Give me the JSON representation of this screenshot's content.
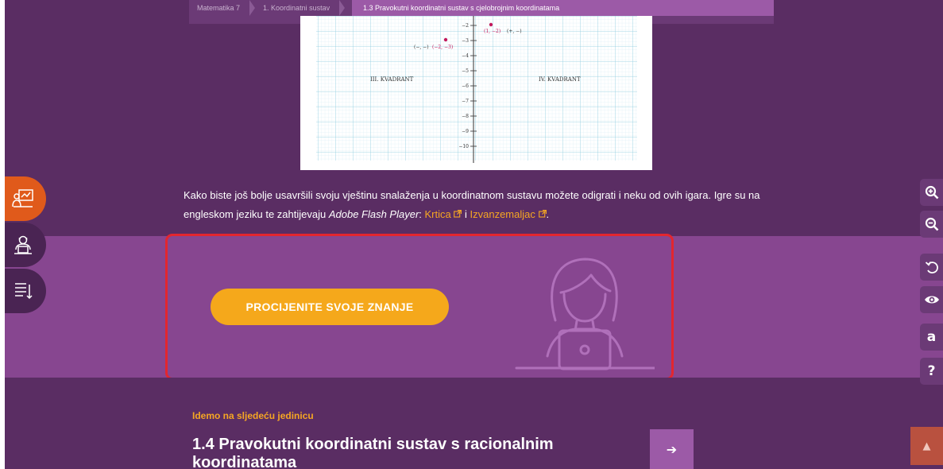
{
  "breadcrumb": {
    "items": [
      "Matematika 7",
      "1. Koordinatni sustav"
    ],
    "active": "1.3 Pravokutni koordinatni sustav s cjelobrojnim koordinatama"
  },
  "graph": {
    "quadrant_left": "III. KVADRANT",
    "quadrant_right": "IV. KVADRANT",
    "sign_left": "(−, −)",
    "point_left": "(−2, −3)",
    "point_right": "(1, −2)",
    "sign_right": "(+, −)",
    "ticks": [
      "−2",
      "−3",
      "−4",
      "−5",
      "−6",
      "−7",
      "−8",
      "−9",
      "−10"
    ]
  },
  "paragraph": {
    "text1": "Kako biste još bolje usavršili svoju vještinu snalaženja u koordinatnom sustavu možete odigrati i neku od ovih igara. Igre su na engleskom jeziku te zahtijevaju ",
    "italic": "Adobe Flash Player",
    "text2": ": ",
    "link1": "Krtica",
    "text3": " i ",
    "link2": "Izvanzemaljac",
    "text4": "."
  },
  "cta": {
    "label": "PROCIJENITE SVOJE ZNANJE"
  },
  "next": {
    "label": "Idemo na sljedeću jedinicu",
    "title": "1.4 Pravokutni koordinatni sustav s racionalnim koordinatama",
    "arrow": "➔"
  },
  "right_tools": {
    "accessible_font": "a",
    "help": "?"
  },
  "scroll_top": {
    "glyph": "▲"
  },
  "colors": {
    "background": "#5a2d63",
    "band": "#874690",
    "accent_orange": "#f5a81b",
    "left_tool_active": "#e05a1b",
    "highlight_border": "#e3262f"
  }
}
